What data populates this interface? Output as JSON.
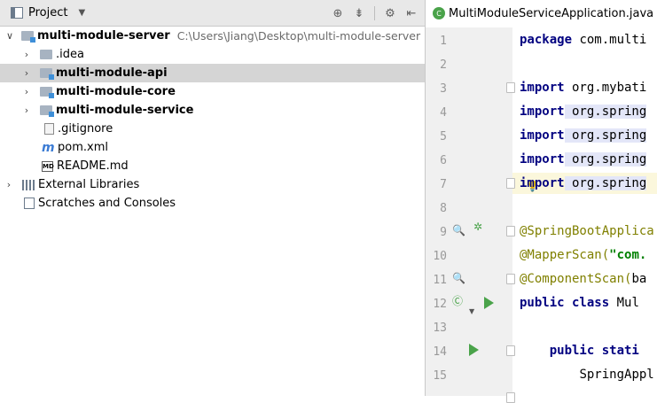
{
  "project_panel": {
    "title": "Project",
    "tree": [
      {
        "label": "multi-module-server",
        "path": "C:\\Users\\Jiang\\Desktop\\multi-module-server",
        "expanded": true,
        "bold": true
      },
      {
        "label": ".idea",
        "expanded": false
      },
      {
        "label": "multi-module-api",
        "expanded": false,
        "bold": true,
        "selected": true
      },
      {
        "label": "multi-module-core",
        "expanded": false,
        "bold": true
      },
      {
        "label": "multi-module-service",
        "expanded": false,
        "bold": true
      },
      {
        "label": ".gitignore"
      },
      {
        "label": "pom.xml"
      },
      {
        "label": "README.md"
      },
      {
        "label": "External Libraries",
        "expanded": false
      },
      {
        "label": "Scratches and Consoles"
      }
    ]
  },
  "editor": {
    "tab_label": "MultiModuleServiceApplication.java",
    "line_numbers": [
      "1",
      "2",
      "3",
      "4",
      "5",
      "6",
      "7",
      "8",
      "9",
      "10",
      "11",
      "12",
      "13",
      "14",
      "15"
    ],
    "lines": [
      {
        "kw": "package",
        "rest": " com.multi"
      },
      {},
      {
        "kw": "import",
        "rest": " org.mybati"
      },
      {
        "kw": "import",
        "rest": " org.spring"
      },
      {
        "kw": "import",
        "rest": " org.spring"
      },
      {
        "kw": "import",
        "rest": " org.spring"
      },
      {
        "kw": "import",
        "rest": " org.spring"
      },
      {},
      {
        "ann": "@SpringBootApplica"
      },
      {
        "ann": "@MapperScan(",
        "str": "\"com."
      },
      {
        "ann": "@ComponentScan(",
        "rest": "ba"
      },
      {
        "kw": "public class",
        "rest": " Mul"
      },
      {},
      {
        "kw": "public stati",
        "indent": "    "
      },
      {
        "rest": "SpringAppl",
        "indent": "        "
      }
    ]
  }
}
